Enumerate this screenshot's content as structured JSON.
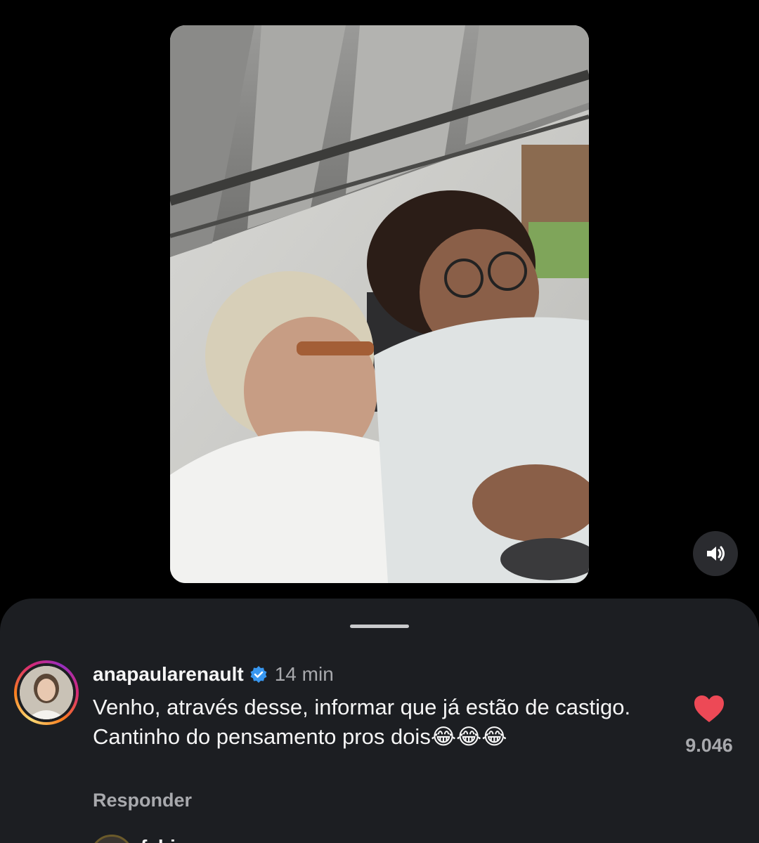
{
  "video": {
    "media_description_icon": "video-frame",
    "sound_icon": "speaker-icon"
  },
  "comment": {
    "username": "anapaularenault",
    "verified_icon": "verified-badge-icon",
    "timestamp": "14 min",
    "text": "Venho, através desse, informar que já estão de castigo. Cantinho do pensamento pros dois😂😂😂",
    "reply_label": "Responder",
    "like_icon": "heart-icon",
    "like_color": "#ed4956",
    "likes": "9.046"
  },
  "next_comment": {
    "username_partial": "fabi"
  },
  "colors": {
    "background": "#000000",
    "sheet": "#1c1e22",
    "secondary_text": "#a8a9ad",
    "verified": "#3897f0"
  }
}
